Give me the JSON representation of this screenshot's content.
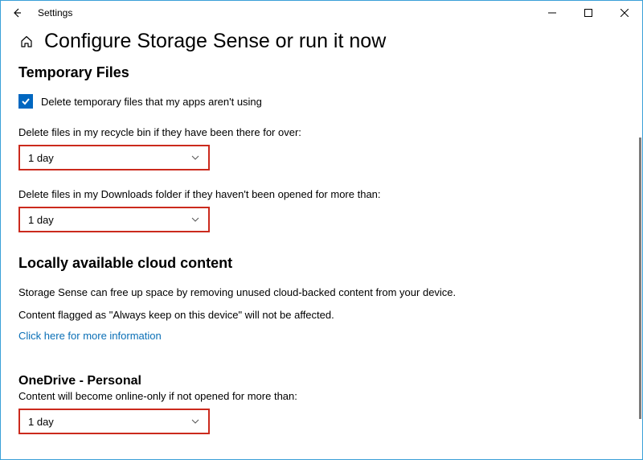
{
  "window": {
    "title": "Settings"
  },
  "page": {
    "title": "Configure Storage Sense or run it now"
  },
  "tempFiles": {
    "heading": "Temporary Files",
    "checkboxLabel": "Delete temporary files that my apps aren't using",
    "recycleLabel": "Delete files in my recycle bin if they have been there for over:",
    "recycleValue": "1 day",
    "downloadsLabel": "Delete files in my Downloads folder if they haven't been opened for more than:",
    "downloadsValue": "1 day"
  },
  "cloud": {
    "heading": "Locally available cloud content",
    "para1": "Storage Sense can free up space by removing unused cloud-backed content from your device.",
    "para2": "Content flagged as \"Always keep on this device\" will not be affected.",
    "link": "Click here for more information",
    "oneDriveHeading": "OneDrive - Personal",
    "oneDriveLabel": "Content will become online-only if not opened for more than:",
    "oneDriveValue": "1 day"
  }
}
